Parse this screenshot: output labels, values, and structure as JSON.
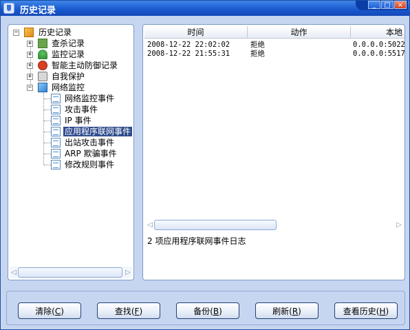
{
  "window": {
    "title": "历史记录",
    "controls": [
      "_",
      "□",
      "×"
    ]
  },
  "tree": {
    "root": "历史记录",
    "nodes": [
      {
        "label": "查杀记录",
        "expander": "+",
        "icon": "scan-icon"
      },
      {
        "label": "监控记录",
        "expander": "+",
        "icon": "umbrella-icon"
      },
      {
        "label": "智能主动防御记录",
        "expander": "+",
        "icon": "defense-icon"
      },
      {
        "label": "自我保护",
        "expander": "+",
        "icon": "lock-icon"
      },
      {
        "label": "网络监控",
        "expander": "−",
        "icon": "network-icon"
      }
    ],
    "children": [
      "网络监控事件",
      "攻击事件",
      "IP 事件",
      "应用程序联网事件",
      "出站攻击事件",
      "ARP 欺骗事件",
      "修改规则事件"
    ],
    "selected_child": "应用程序联网事件"
  },
  "list": {
    "columns": [
      "时间",
      "动作",
      "本地"
    ],
    "rows": [
      {
        "time": "2008-12-22 22:02:02",
        "action": "拒绝",
        "local": "0.0.0.0:5022"
      },
      {
        "time": "2008-12-22 21:55:31",
        "action": "拒绝",
        "local": "0.0.0.0:5517"
      }
    ],
    "status": "2 项应用程序联网事件日志"
  },
  "buttons": {
    "clear": {
      "label": "清除",
      "key": "C"
    },
    "find": {
      "label": "查找",
      "key": "F"
    },
    "backup": {
      "label": "备份",
      "key": "B"
    },
    "refresh": {
      "label": "刷新",
      "key": "R"
    },
    "history": {
      "label": "查看历史",
      "key": "H"
    }
  },
  "scroll_arrows": {
    "left": "◁",
    "right": "▷"
  }
}
